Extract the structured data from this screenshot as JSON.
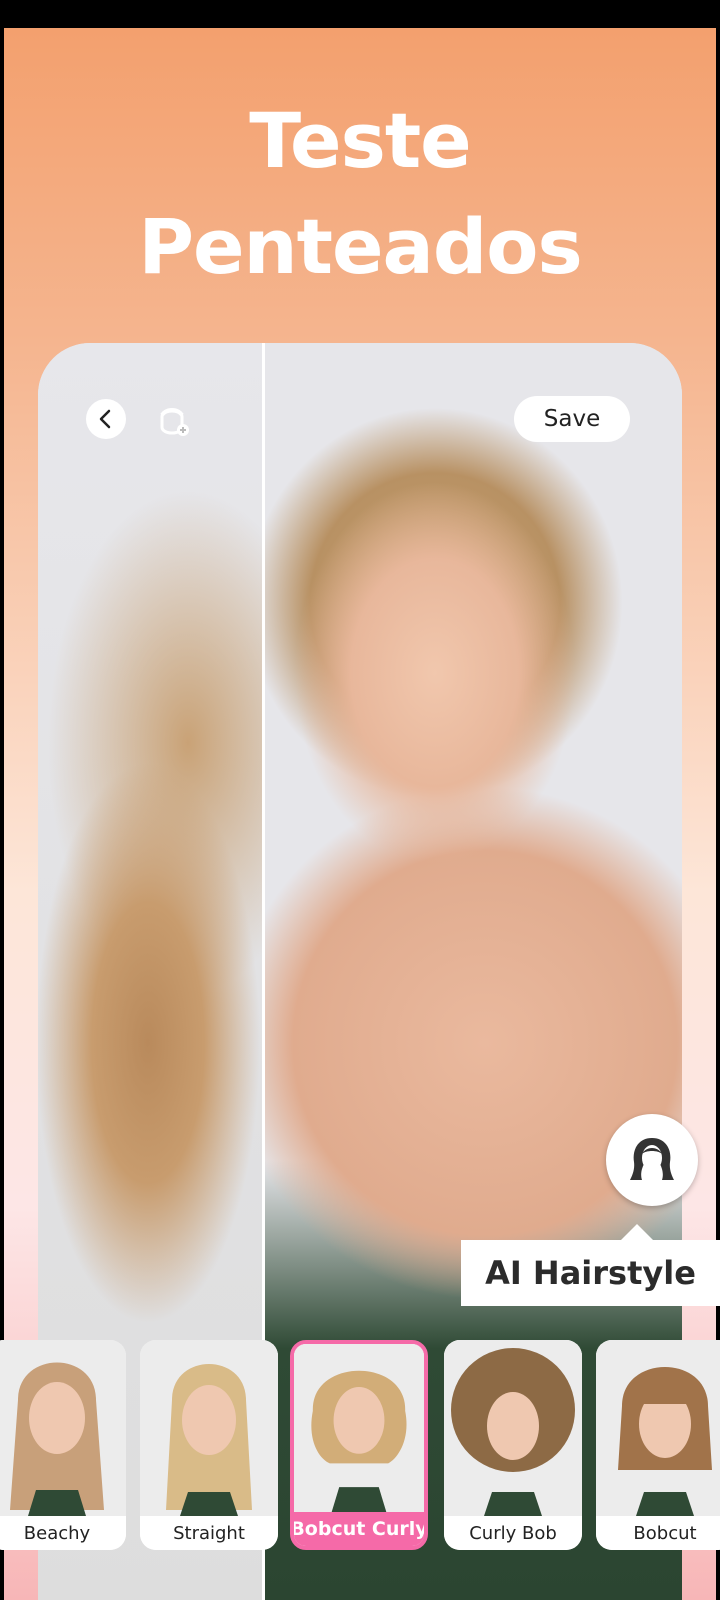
{
  "header": {
    "title_line1": "Teste",
    "title_line2": "Penteados"
  },
  "editor": {
    "save_label": "Save",
    "back_icon": "chevron-left-icon",
    "face_icon": "face-swap-icon"
  },
  "ai_hairstyle": {
    "icon": "hair-silhouette-icon",
    "tooltip": "AI Hairstyle"
  },
  "styles": [
    {
      "label": "Beachy",
      "selected": false,
      "hair": "#c8a07a"
    },
    {
      "label": "Straight",
      "selected": false,
      "hair": "#d9bb88"
    },
    {
      "label": "Bobcut Curly",
      "selected": true,
      "hair": "#d2ad78"
    },
    {
      "label": "Curly Bob",
      "selected": false,
      "hair": "#8d6a45"
    },
    {
      "label": "Bobcut",
      "selected": false,
      "hair": "#a1734a"
    }
  ],
  "colors": {
    "accent": "#f56aa8",
    "background_top": "#f3a06e",
    "background_bottom": "#f7b6b7"
  }
}
